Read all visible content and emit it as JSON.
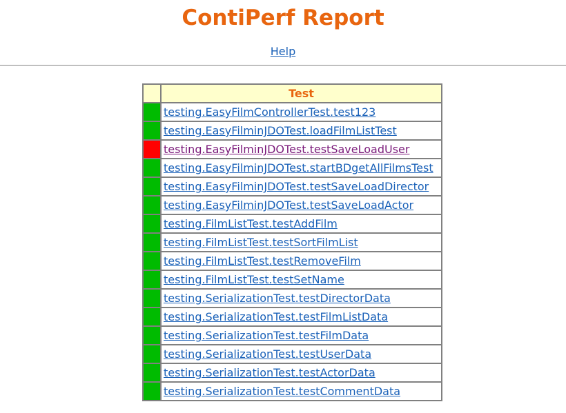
{
  "header": {
    "title": "ContiPerf Report",
    "help_label": "Help"
  },
  "table": {
    "column_header": "Test",
    "rows": [
      {
        "name": "testing.EasyFilmControllerTest.test123",
        "status": "pass"
      },
      {
        "name": "testing.EasyFilminJDOTest.loadFilmListTest",
        "status": "pass"
      },
      {
        "name": "testing.EasyFilminJDOTest.testSaveLoadUser",
        "status": "fail"
      },
      {
        "name": "testing.EasyFilminJDOTest.startBDgetAllFilmsTest",
        "status": "pass"
      },
      {
        "name": "testing.EasyFilminJDOTest.testSaveLoadDirector",
        "status": "pass"
      },
      {
        "name": "testing.EasyFilminJDOTest.testSaveLoadActor",
        "status": "pass"
      },
      {
        "name": "testing.FilmListTest.testAddFilm",
        "status": "pass"
      },
      {
        "name": "testing.FilmListTest.testSortFilmList",
        "status": "pass"
      },
      {
        "name": "testing.FilmListTest.testRemoveFilm",
        "status": "pass"
      },
      {
        "name": "testing.FilmListTest.testSetName",
        "status": "pass"
      },
      {
        "name": "testing.SerializationTest.testDirectorData",
        "status": "pass"
      },
      {
        "name": "testing.SerializationTest.testFilmListData",
        "status": "pass"
      },
      {
        "name": "testing.SerializationTest.testFilmData",
        "status": "pass"
      },
      {
        "name": "testing.SerializationTest.testUserData",
        "status": "pass"
      },
      {
        "name": "testing.SerializationTest.testActorData",
        "status": "pass"
      },
      {
        "name": "testing.SerializationTest.testCommentData",
        "status": "pass"
      }
    ]
  },
  "colors": {
    "title": "#e8650f",
    "link": "#1a61b8",
    "visited_link": "#7b1b7b",
    "pass": "#00bb00",
    "fail": "#ff0000",
    "header_bg": "#ffffcc"
  }
}
